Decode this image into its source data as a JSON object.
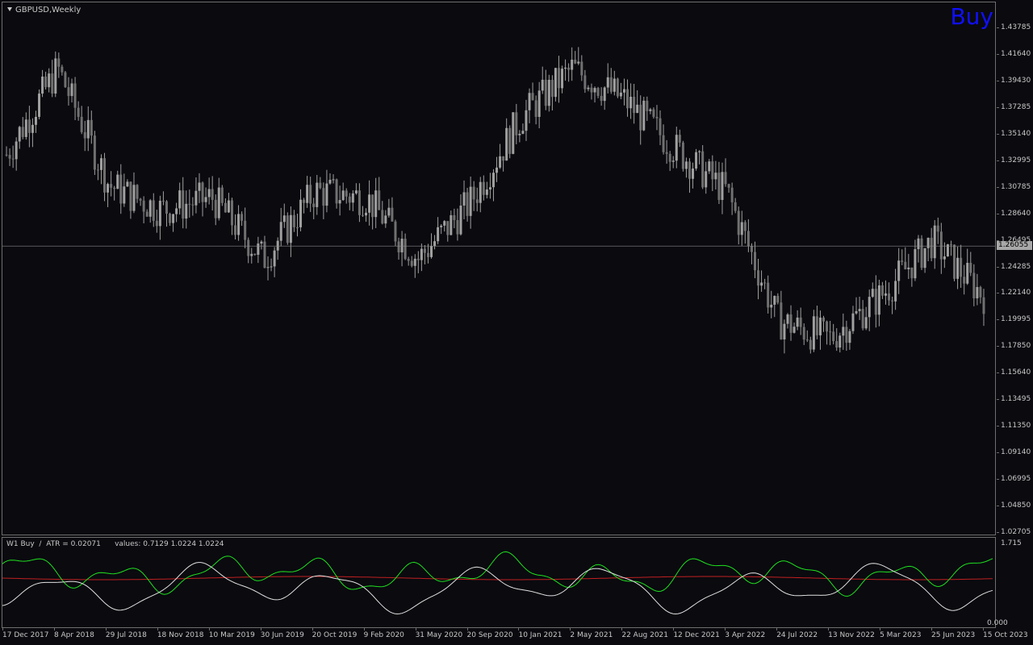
{
  "chart_title": "GBPUSD,Weekly",
  "signal_label": "Buy",
  "signal_color": "#1010ff",
  "current_price": "1.26055",
  "indicator": {
    "name": "W1 Buy",
    "atr_text": "ATR = 0.02071",
    "values_text": "values: 0.7129 1.0224 1.0224",
    "scale_top": "1.715",
    "scale_bottom": "0.000"
  },
  "price_scale_labels": [
    "1.43785",
    "1.41640",
    "1.39430",
    "1.37285",
    "1.35140",
    "1.32995",
    "1.30785",
    "1.28640",
    "1.26495",
    "1.24285",
    "1.22140",
    "1.19995",
    "1.17850",
    "1.15640",
    "1.13495",
    "1.11350",
    "1.09140",
    "1.06995",
    "1.04850",
    "1.02705"
  ],
  "time_axis_labels": [
    "17 Dec 2017",
    "8 Apr 2018",
    "29 Jul 2018",
    "18 Nov 2018",
    "10 Mar 2019",
    "30 Jun 2019",
    "20 Oct 2019",
    "9 Feb 2020",
    "31 May 2020",
    "20 Sep 2020",
    "10 Jan 2021",
    "2 May 2021",
    "22 Aug 2021",
    "12 Dec 2021",
    "3 Apr 2022",
    "24 Jul 2022",
    "13 Nov 2022",
    "5 Mar 2023",
    "25 Jun 2023",
    "15 Oct 2023"
  ],
  "colors": {
    "background": "#0a0a0f",
    "candle": "#a0a0a0",
    "grid_line": "#6e6e6e",
    "green_line": "#20e020",
    "white_line": "#e0e0e0",
    "red_line": "#c02020"
  },
  "chart_data": {
    "type": "line",
    "x": [
      "17 Dec 2017",
      "8 Apr 2018",
      "29 Jul 2018",
      "18 Nov 2018",
      "10 Mar 2019",
      "30 Jun 2019",
      "20 Oct 2019",
      "9 Feb 2020",
      "31 May 2020",
      "20 Sep 2020",
      "10 Jan 2021",
      "2 May 2021",
      "22 Aug 2021",
      "12 Dec 2021",
      "3 Apr 2022",
      "24 Jul 2022",
      "13 Nov 2022",
      "5 Mar 2023",
      "25 Jun 2023",
      "15 Oct 2023"
    ],
    "series": [
      {
        "values": [
          1.335,
          1.405,
          1.31,
          1.29,
          1.3,
          1.25,
          1.305,
          1.3,
          1.25,
          1.295,
          1.365,
          1.405,
          1.38,
          1.34,
          1.305,
          1.2,
          1.185,
          1.22,
          1.265,
          1.22
        ]
      }
    ],
    "ylim": [
      1.02705,
      1.43785
    ],
    "current_price": 1.26055
  }
}
